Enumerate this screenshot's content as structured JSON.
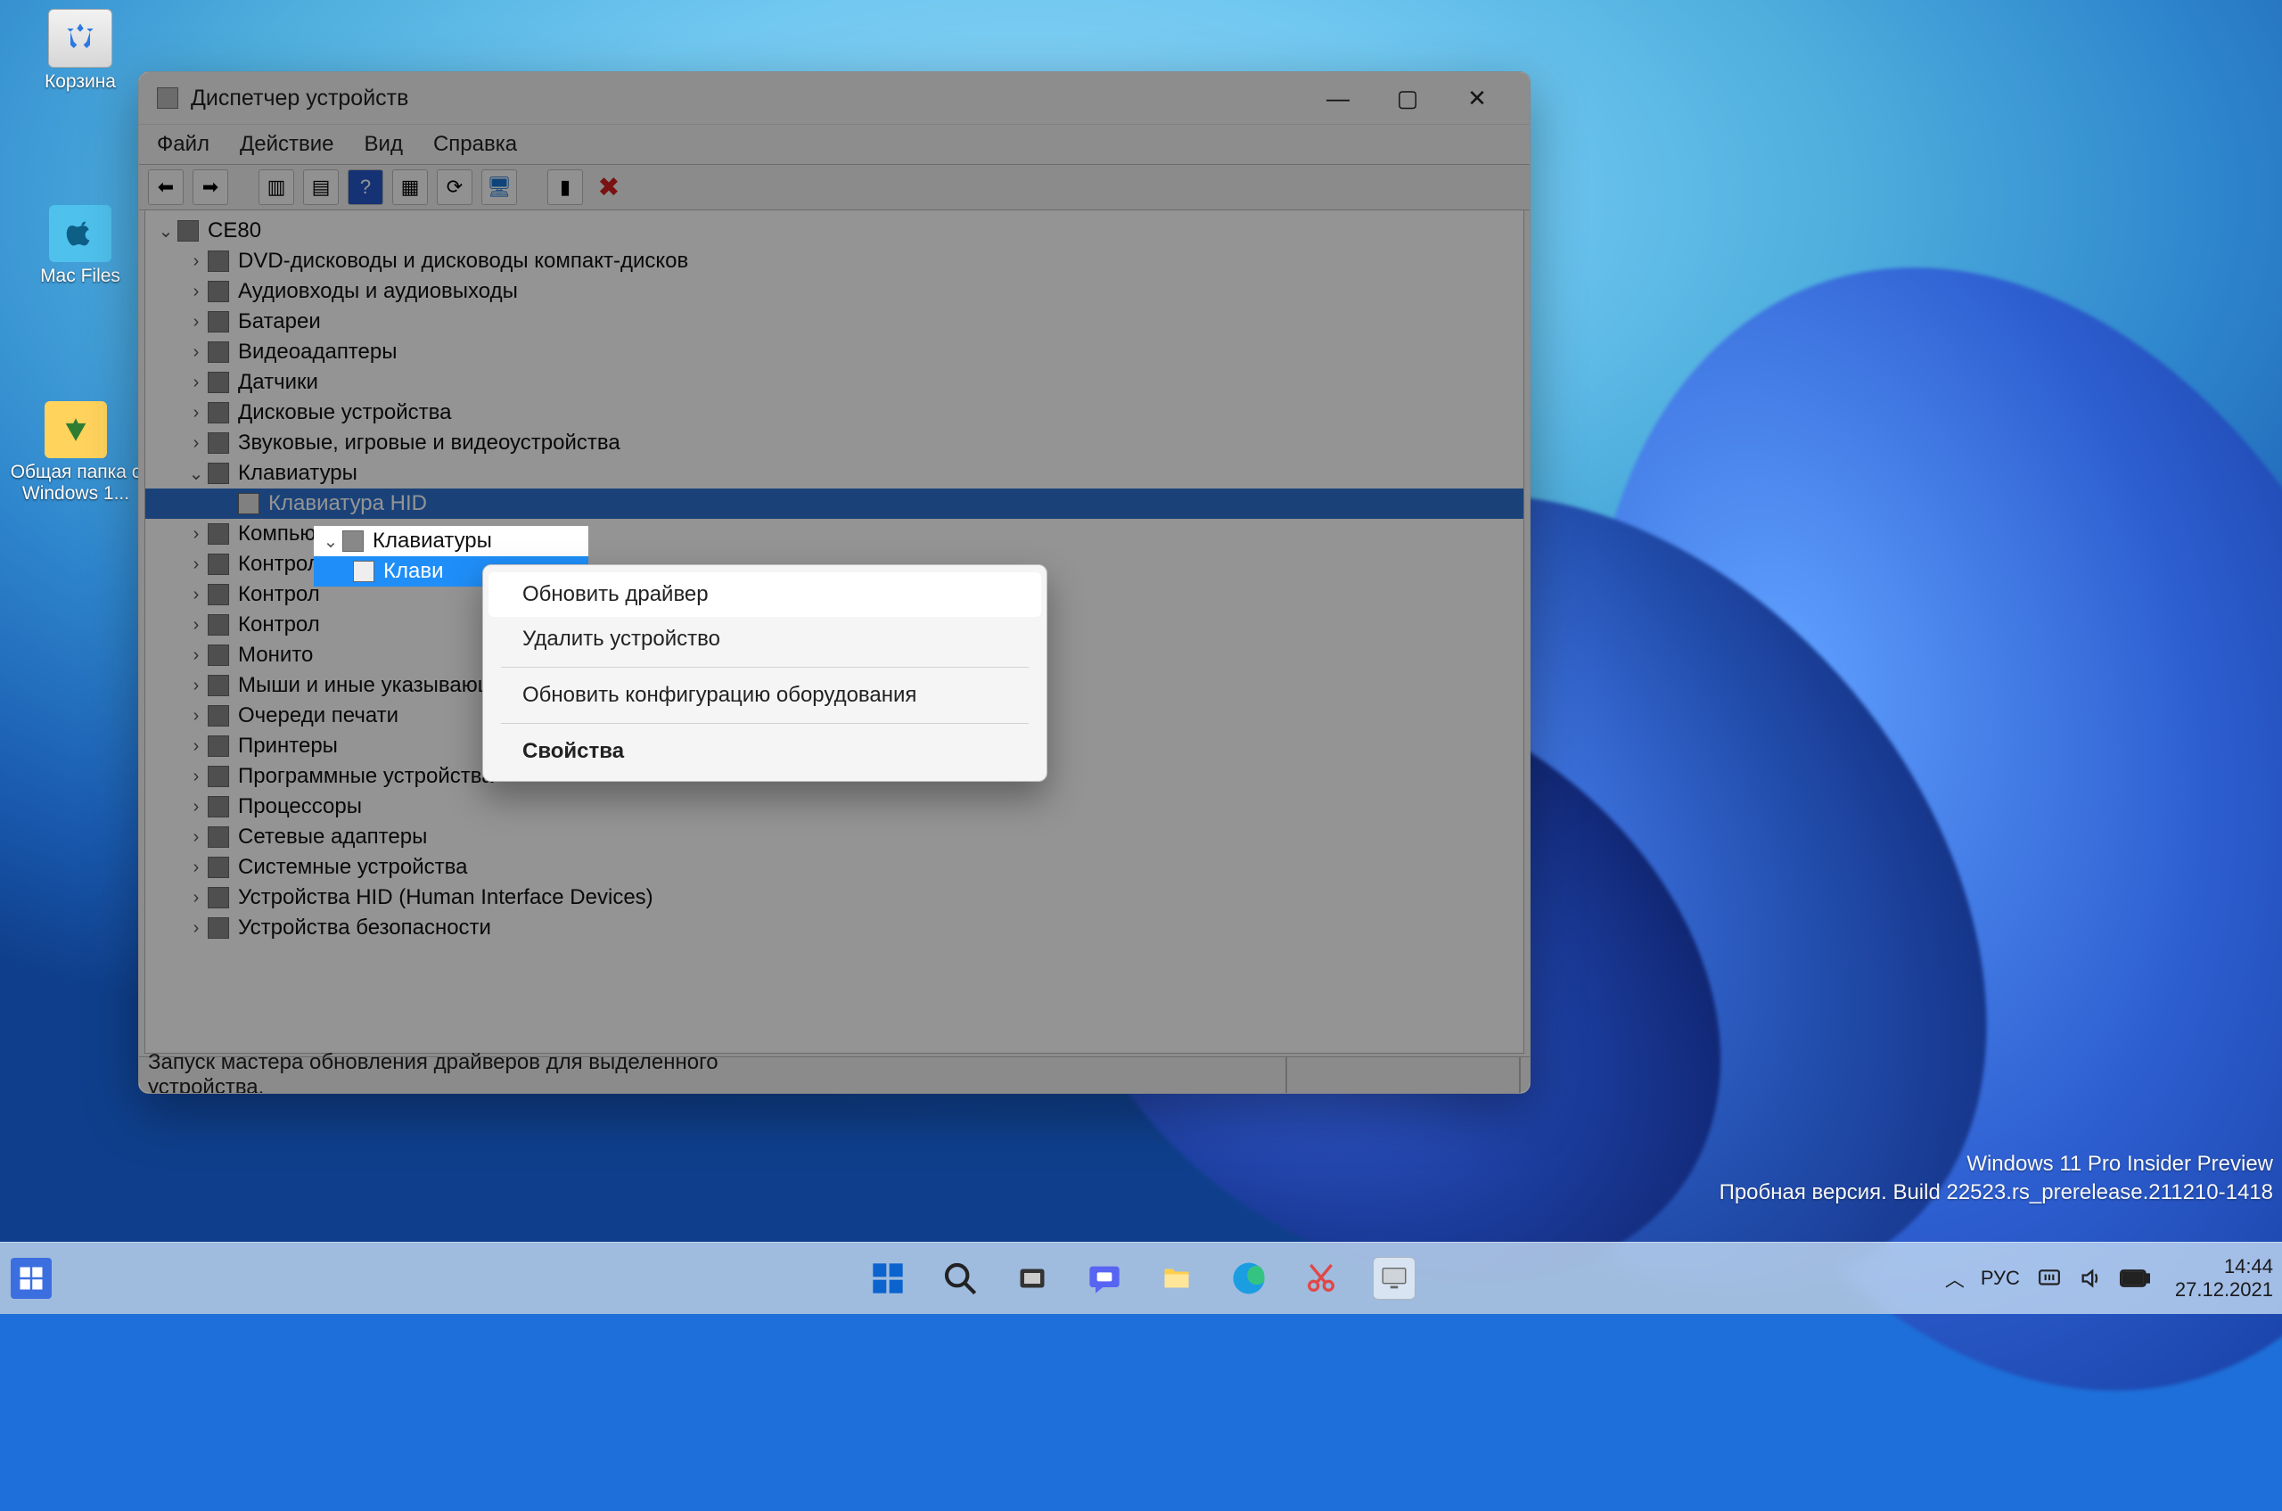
{
  "desktop": {
    "icons": [
      {
        "label": "Корзина",
        "kind": "recycle-bin"
      },
      {
        "label": "Mac Files",
        "kind": "folder-mac"
      },
      {
        "label": "Общая папка с Windows 1...",
        "kind": "folder-share"
      }
    ],
    "watermark_line1": "Windows 11 Pro Insider Preview",
    "watermark_line2": "Пробная версия. Build 22523.rs_prerelease.211210-1418"
  },
  "window": {
    "title": "Диспетчер устройств",
    "menu": [
      "Файл",
      "Действие",
      "Вид",
      "Справка"
    ],
    "root": "CE80",
    "categories": [
      {
        "label": "DVD-дисководы и дисководы компакт-дисков",
        "expanded": false
      },
      {
        "label": "Аудиовходы и аудиовыходы",
        "expanded": false
      },
      {
        "label": "Батареи",
        "expanded": false
      },
      {
        "label": "Видеоадаптеры",
        "expanded": false
      },
      {
        "label": "Датчики",
        "expanded": false
      },
      {
        "label": "Дисковые устройства",
        "expanded": false
      },
      {
        "label": "Звуковые, игровые и видеоустройства",
        "expanded": false
      },
      {
        "label": "Клавиатуры",
        "expanded": true,
        "children": [
          {
            "label": "Клавиатура HID",
            "selected": true
          }
        ]
      },
      {
        "label": "Компью",
        "expanded": false
      },
      {
        "label": "Контрол",
        "expanded": false
      },
      {
        "label": "Контрол",
        "expanded": false
      },
      {
        "label": "Контрол",
        "expanded": false
      },
      {
        "label": "Монито",
        "expanded": false
      },
      {
        "label": "Мыши и иные указывающие устройства",
        "expanded": false
      },
      {
        "label": "Очереди печати",
        "expanded": false
      },
      {
        "label": "Принтеры",
        "expanded": false
      },
      {
        "label": "Программные устройства",
        "expanded": false
      },
      {
        "label": "Процессоры",
        "expanded": false
      },
      {
        "label": "Сетевые адаптеры",
        "expanded": false
      },
      {
        "label": "Системные устройства",
        "expanded": false
      },
      {
        "label": "Устройства HID (Human Interface Devices)",
        "expanded": false
      },
      {
        "label": "Устройства безопасности",
        "expanded": false
      }
    ],
    "statusbar": "Запуск мастера обновления драйверов для выделенного устройства."
  },
  "context_menu": {
    "items": [
      {
        "label": "Обновить драйвер",
        "hover": true
      },
      {
        "label": "Удалить устройство"
      },
      {
        "sep": true
      },
      {
        "label": "Обновить конфигурацию оборудования"
      },
      {
        "sep": true
      },
      {
        "label": "Свойства",
        "bold": true
      }
    ]
  },
  "taskbar": {
    "lang": "РУС",
    "time": "14:44",
    "date": "27.12.2021"
  }
}
